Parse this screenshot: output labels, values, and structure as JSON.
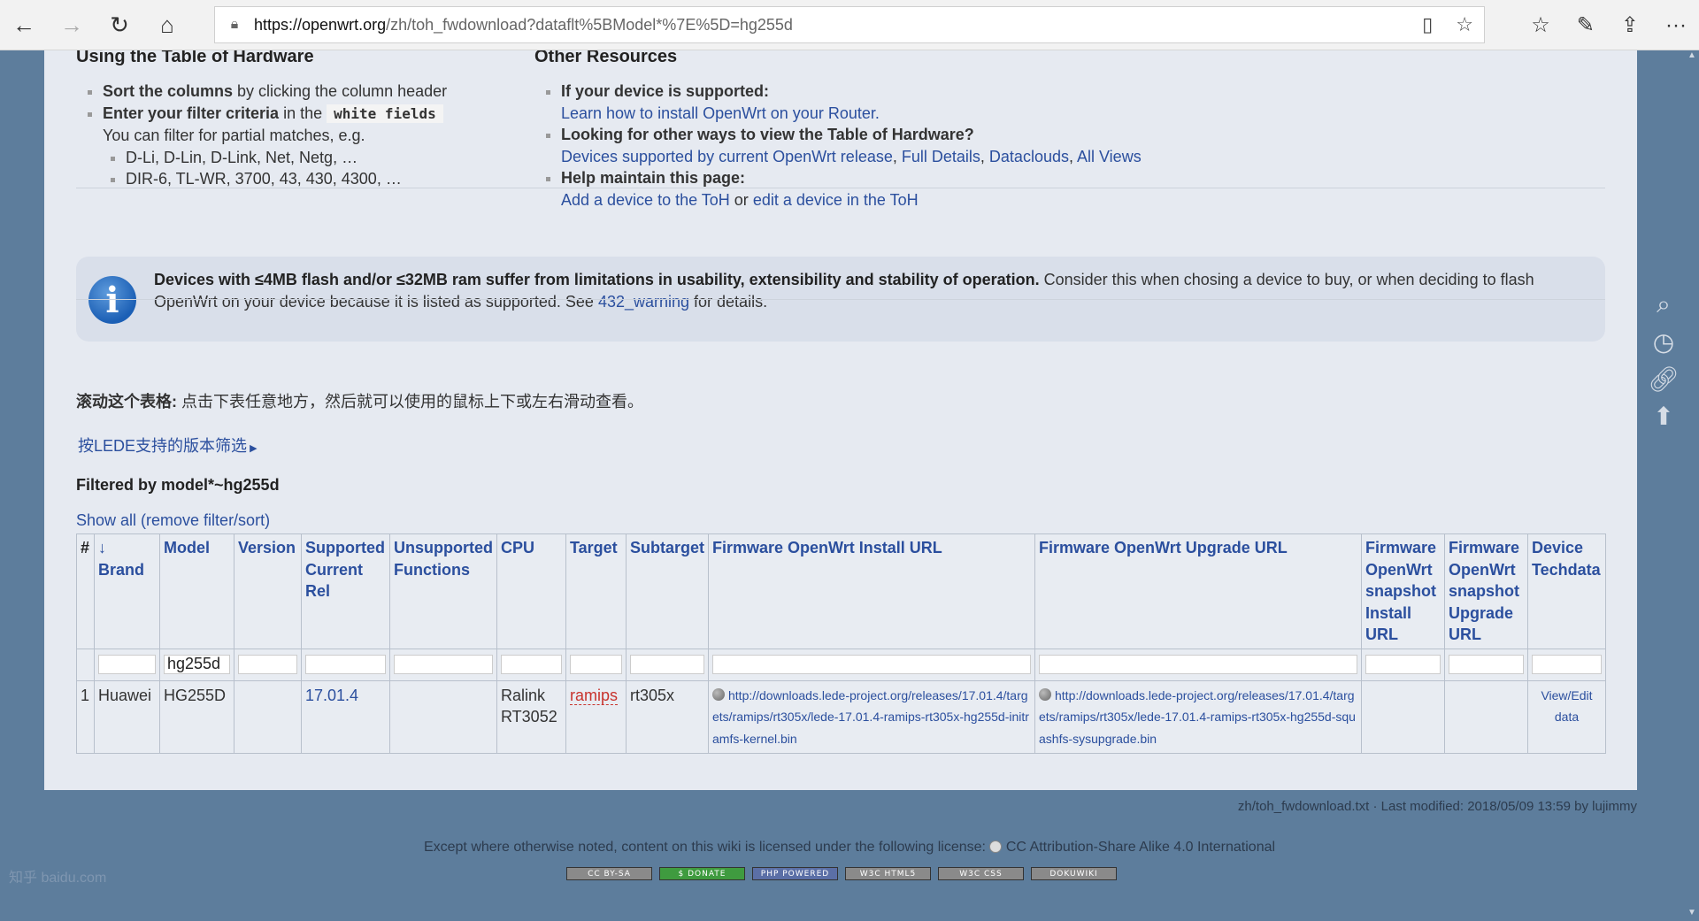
{
  "browser": {
    "url_host": "https://openwrt.org",
    "url_rest": "/zh/toh_fwdownload?dataflt%5BModel*%7E%5D=hg255d"
  },
  "left_col": {
    "heading": "Using the Table of Hardware",
    "item1_bold": "Sort the columns",
    "item1_rest": " by clicking the column header",
    "item2_bold": "Enter your filter criteria",
    "item2_mid": " in the ",
    "item2_code": "white fields",
    "item2_sub": "You can filter for partial matches, e.g.",
    "ex1": "D-Li, D-Lin, D-Link, Net, Netg, …",
    "ex2": "DIR-6, TL-WR, 3700, 43, 430, 4300, …"
  },
  "right_col": {
    "heading": "Other Resources",
    "q1": "If your device is supported:",
    "a1": "Learn how to install OpenWrt on your Router.",
    "q2": "Looking for other ways to view the Table of Hardware?",
    "a2_link1": "Devices supported by current OpenWrt release",
    "a2_link2": "Full Details",
    "a2_link3": "Dataclouds",
    "a2_link4": "All Views",
    "q3": "Help maintain this page:",
    "a3_link1": "Add a device to the ToH",
    "a3_or": " or ",
    "a3_link2": "edit a device in the ToH"
  },
  "notice": {
    "bold": "Devices with ≤4MB flash and/or ≤32MB ram suffer from limitations in usability, extensibility and stability of operation.",
    "rest": " Consider this when chosing a device to buy, or when deciding to flash OpenWrt on your device because it is listed as supported. See ",
    "link": "432_warning",
    "tail": " for details."
  },
  "scroll_note_bold": "滚动这个表格:",
  "scroll_note_rest": " 点击下表任意地方，然后就可以使用的鼠标上下或左右滑动查看。",
  "lede_filter": "按LEDE支持的版本筛选",
  "filtered_by": "Filtered by model*~hg255d",
  "show_all": "Show all (remove filter/sort)",
  "table": {
    "headers": {
      "num": "#",
      "brand": "↓ Brand",
      "model": "Model",
      "version": "Version",
      "supported": "Supported Current Rel",
      "unsupported": "Unsupported Functions",
      "cpu": "CPU",
      "target": "Target",
      "subtarget": "Subtarget",
      "install": "Firmware OpenWrt Install URL",
      "upgrade": "Firmware OpenWrt Upgrade URL",
      "snap_install": "Firmware OpenWrt snapshot Install URL",
      "snap_upgrade": "Firmware OpenWrt snapshot Upgrade URL",
      "techdata": "Device Techdata"
    },
    "filter_model_value": "hg255d",
    "row": {
      "num": "1",
      "brand": "Huawei",
      "model": "HG255D",
      "version": "",
      "supported": "17.01.4",
      "unsupported": "",
      "cpu": "Ralink RT3052",
      "target": "ramips",
      "subtarget": "rt305x",
      "install": "http://downloads.lede-project.org/releases/17.01.4/targets/ramips/rt305x/lede-17.01.4-ramips-rt305x-hg255d-initramfs-kernel.bin",
      "upgrade": "http://downloads.lede-project.org/releases/17.01.4/targets/ramips/rt305x/lede-17.01.4-ramips-rt305x-hg255d-squashfs-sysupgrade.bin",
      "snap_install": "",
      "snap_upgrade": "",
      "techdata": "View/Edit data"
    }
  },
  "footer": {
    "lastmod": "zh/toh_fwdownload.txt · Last modified: 2018/05/09 13:59 by lujimmy",
    "license_pre": "Except where otherwise noted, content on this wiki is licensed under the following license: ",
    "license_link": "CC Attribution-Share Alike 4.0 International",
    "badges": [
      "CC BY-SA",
      "$ DONATE",
      "PHP POWERED",
      "W3C HTML5",
      "W3C CSS",
      "DOKUWIKI"
    ],
    "faint_text": "知乎 baidu.com"
  },
  "colors": {
    "link": "#2b4f9e",
    "page_bg": "#e6eaf1",
    "overlay_bg": "#5d7d9c",
    "red_link": "#c8332d"
  }
}
